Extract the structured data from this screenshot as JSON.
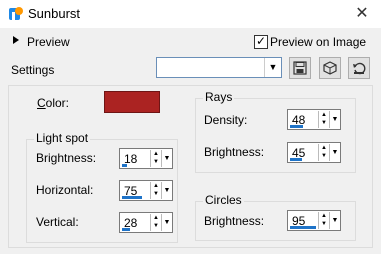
{
  "window": {
    "title": "Sunburst",
    "close_glyph": "✕"
  },
  "preview": {
    "label": "Preview",
    "on_image_label": "Preview on Image",
    "on_image_checked": true
  },
  "settings": {
    "label": "Settings",
    "preset_value": ""
  },
  "color": {
    "label": "Color:",
    "swatch": "#ab2322"
  },
  "light_spot": {
    "title": "Light spot",
    "brightness": {
      "label": "Brightness:",
      "value": "18",
      "fraction": 0.18
    },
    "horizontal": {
      "label": "Horizontal:",
      "value": "75",
      "fraction": 0.75
    },
    "vertical": {
      "label": "Vertical:",
      "value": "28",
      "fraction": 0.28
    }
  },
  "rays": {
    "title": "Rays",
    "density": {
      "label": "Density:",
      "value": "48",
      "fraction": 0.48
    },
    "brightness": {
      "label": "Brightness:",
      "value": "45",
      "fraction": 0.45
    }
  },
  "circles": {
    "title": "Circles",
    "brightness": {
      "label": "Brightness:",
      "value": "95",
      "fraction": 0.95
    }
  },
  "icons": [
    "app-icon",
    "close-icon",
    "expand-triangle-icon",
    "checkbox-check-icon",
    "dropdown-arrow-icon",
    "save-preset-icon",
    "load-preset-icon",
    "reset-icon",
    "spin-up-icon",
    "spin-down-icon"
  ]
}
